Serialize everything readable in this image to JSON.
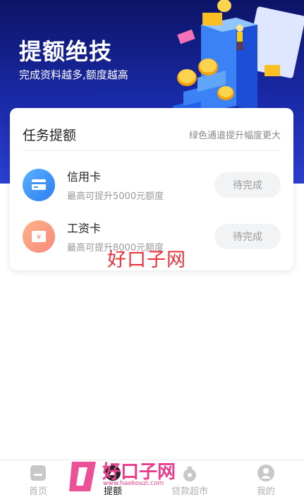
{
  "hero": {
    "title": "提额绝技",
    "subtitle": "完成资料越多,额度越高"
  },
  "task_card": {
    "title": "任务提额",
    "hint": "绿色通道提升幅度更大",
    "items": [
      {
        "name": "信用卡",
        "desc": "最高可提升5000元额度",
        "button": "待完成",
        "icon": "credit-card-icon",
        "color": "#3f93f7"
      },
      {
        "name": "工资卡",
        "desc": "最高可提升8000元额度",
        "button": "待完成",
        "icon": "salary-card-icon",
        "color": "#f79a7e"
      }
    ]
  },
  "watermark": {
    "text": "好口子网"
  },
  "brand": {
    "name": "好口子网",
    "url": "www.haokouzi.com"
  },
  "tabbar": {
    "tabs": [
      {
        "label": "首页",
        "icon": "home-icon",
        "active": false
      },
      {
        "label": "提额",
        "icon": "boost-icon",
        "active": true
      },
      {
        "label": "贷款超市",
        "icon": "money-bag-icon",
        "active": false
      },
      {
        "label": "我的",
        "icon": "user-icon",
        "active": false
      }
    ]
  },
  "colors": {
    "hero_dark": "#0c1466",
    "hero_light": "#2b3fd0",
    "inactive_tab": "#b0b0b0",
    "brand_pink": "#e83e8c",
    "watermark_red": "#e8323c"
  }
}
